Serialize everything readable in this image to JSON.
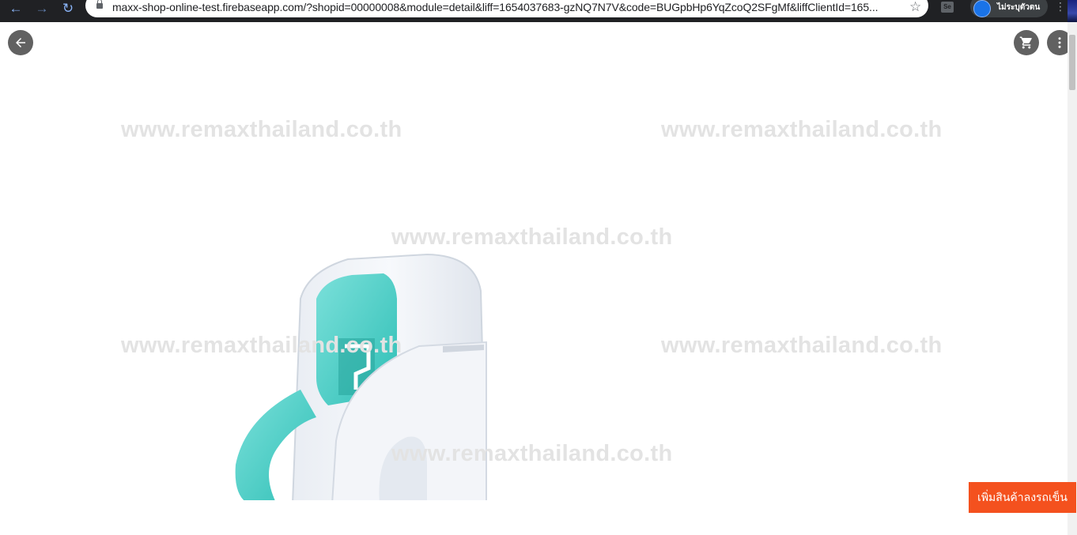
{
  "browser": {
    "url": "maxx-shop-online-test.firebaseapp.com/?shopid=00000008&module=detail&liff=1654037683-gzNQ7N7V&code=BUGpbHp6YqZcoQ2SFgMf&liffClientId=165...",
    "profile_label": "ไม่ระบุตัวตน",
    "back_glyph": "←",
    "forward_glyph": "→",
    "reload_glyph": "↻",
    "star_glyph": "☆",
    "extension_text": "Se",
    "menu_glyph": "⋮"
  },
  "watermark": {
    "text": "www.remaxthailand.co.th"
  },
  "colors": {
    "accent": "#f4511e",
    "round_button": "#616161",
    "watermark": "#e3e3e3",
    "product_teal": "#4dd0c8"
  },
  "icons": {
    "back": "arrow-left-icon",
    "cart": "shopping-cart-icon",
    "more": "more-vert-icon"
  },
  "actions": {
    "add_to_cart_label": "เพิ่มสินค้าลงรถเข็น"
  }
}
